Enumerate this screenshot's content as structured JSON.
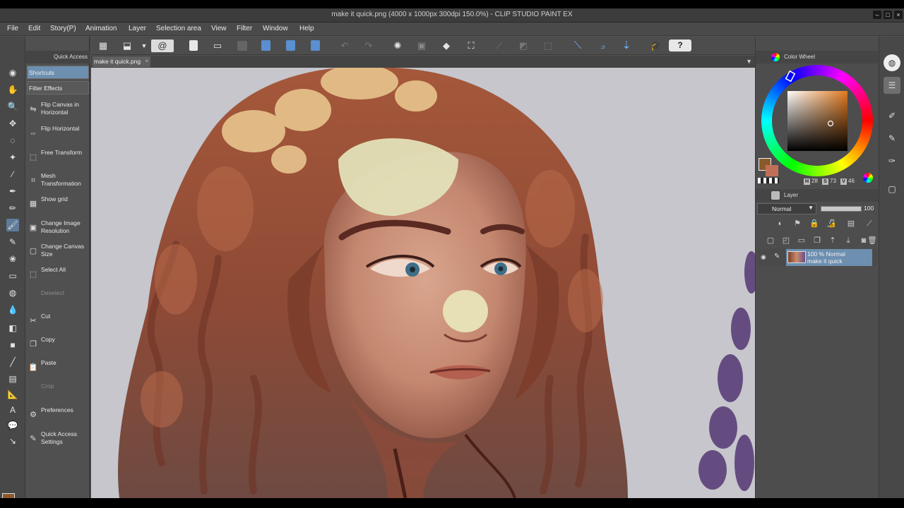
{
  "window": {
    "title": "make it quick.png (4000 x 1000px 300dpi 150.0%) - CLIP STUDIO PAINT EX"
  },
  "menu": [
    "File",
    "Edit",
    "Story(P)",
    "Animation",
    "Layer",
    "Selection area",
    "View",
    "Filter",
    "Window",
    "Help"
  ],
  "quick_access": {
    "title": "Quick Access",
    "tabs": [
      "Shortcuts",
      "Filter Effects"
    ],
    "items": [
      {
        "label": "Flip Canvas in Horizontal",
        "icon": "flip-canvas-icon",
        "glyph": "⇋",
        "disabled": false
      },
      {
        "label": "Flip Horizontal",
        "icon": "flip-horizontal-icon",
        "glyph": "⇔",
        "disabled": false
      },
      {
        "label": "Free Transform",
        "icon": "free-transform-icon",
        "glyph": "⬚",
        "disabled": false
      },
      {
        "label": "Mesh Transformation",
        "icon": "mesh-transform-icon",
        "glyph": "⌗",
        "disabled": false
      },
      {
        "label": "Show grid",
        "icon": "grid-icon",
        "glyph": "▦",
        "disabled": false
      },
      {
        "label": "Change Image Resolution",
        "icon": "image-resolution-icon",
        "glyph": "▣",
        "disabled": false
      },
      {
        "label": "Change Canvas Size",
        "icon": "canvas-size-icon",
        "glyph": "▢",
        "disabled": false
      },
      {
        "label": "Select All",
        "icon": "select-all-icon",
        "glyph": "⬚",
        "disabled": false
      },
      {
        "label": "Deselect",
        "icon": "deselect-icon",
        "glyph": "",
        "disabled": true
      },
      {
        "label": "Cut",
        "icon": "cut-icon",
        "glyph": "✂",
        "disabled": false
      },
      {
        "label": "Copy",
        "icon": "copy-icon",
        "glyph": "❐",
        "disabled": false
      },
      {
        "label": "Paste",
        "icon": "paste-icon",
        "glyph": "📋",
        "disabled": false
      },
      {
        "label": "Crop",
        "icon": "crop-icon",
        "glyph": "",
        "disabled": true
      },
      {
        "label": "Preferences",
        "icon": "preferences-icon",
        "glyph": "⚙",
        "disabled": false
      },
      {
        "label": "Quick Access Settings",
        "icon": "quick-access-settings-icon",
        "glyph": "✎",
        "disabled": false
      }
    ]
  },
  "document_tab": {
    "label": "make it quick.png",
    "close": "×"
  },
  "color_wheel": {
    "title": "Color Wheel",
    "h": "28",
    "s": "73",
    "v": "46",
    "h_label": "H",
    "s_label": "S",
    "v_label": "V",
    "main_color": "#8b5a2b",
    "sub_color": "#c07058"
  },
  "layer_panel": {
    "title": "Layer",
    "blend_mode": "Normal",
    "opacity": "100",
    "opacity_fraction": 1.0,
    "layers": [
      {
        "line1": "100 % Normal",
        "line2": "make it quick"
      }
    ]
  },
  "colors": {
    "accent": "#6d8fb0",
    "panel": "#505050",
    "canvas_bg": "#c6c6cc"
  }
}
